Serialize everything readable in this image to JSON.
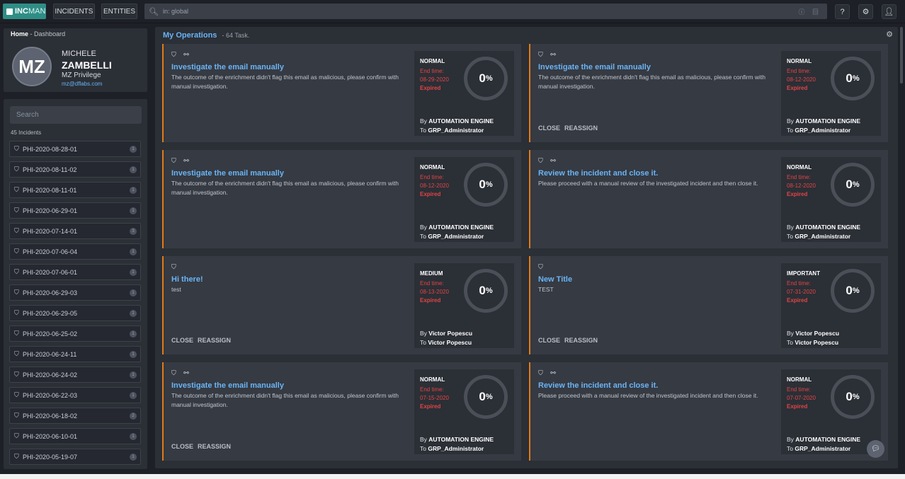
{
  "app": {
    "logo_bold": "INC",
    "logo_light": "MAN",
    "nav": [
      "INCIDENTS",
      "ENTITIES"
    ],
    "search_text": "in: global",
    "search_right_icons": "ⓘ ▤",
    "toolbar_icons": [
      "help-icon",
      "gear-icon",
      "user-icon"
    ]
  },
  "sidebar": {
    "breadcrumb_home": "Home",
    "breadcrumb_sep": "-",
    "breadcrumb_current": "Dashboard",
    "avatar": "MZ",
    "first_name": "MICHELE",
    "last_name": "ZAMBELLI",
    "privilege": "MZ Privilege",
    "email": "mz@dflabs.com",
    "search_placeholder": "Search",
    "incident_count": "45 Incidents",
    "incidents": [
      {
        "id": "PHI-2020-08-28-01",
        "count": "1"
      },
      {
        "id": "PHI-2020-08-11-02",
        "count": "1"
      },
      {
        "id": "PHI-2020-08-11-01",
        "count": "1"
      },
      {
        "id": "PHI-2020-06-29-01",
        "count": "1"
      },
      {
        "id": "PHI-2020-07-14-01",
        "count": "3"
      },
      {
        "id": "PHI-2020-07-06-04",
        "count": "1"
      },
      {
        "id": "PHI-2020-07-06-01",
        "count": "1"
      },
      {
        "id": "PHI-2020-06-29-03",
        "count": "1"
      },
      {
        "id": "PHI-2020-06-29-05",
        "count": "1"
      },
      {
        "id": "PHI-2020-06-25-02",
        "count": "1"
      },
      {
        "id": "PHI-2020-06-24-11",
        "count": "1"
      },
      {
        "id": "PHI-2020-06-24-02",
        "count": "1"
      },
      {
        "id": "PHI-2020-06-22-03",
        "count": "1"
      },
      {
        "id": "PHI-2020-06-18-02",
        "count": "2"
      },
      {
        "id": "PHI-2020-06-10-01",
        "count": "1"
      },
      {
        "id": "PHI-2020-05-19-07",
        "count": "1"
      }
    ]
  },
  "main": {
    "title": "My Operations",
    "subtitle": "- 64 Task.",
    "end_label": "End time:",
    "expired_label": "Expired",
    "by_label": "By",
    "to_label": "To",
    "close_label": "CLOSE",
    "reassign_label": "REASSIGN",
    "tasks": [
      {
        "title": "Investigate the email manually",
        "desc": "The outcome of the enrichment didn't flag this email as malicious, please confirm with manual investigation.",
        "priority": "NORMAL",
        "end": "08-29-2020",
        "progress": "0",
        "by": "AUTOMATION ENGINE",
        "to": "GRP_Administrator",
        "icons": "⛉ ⚯",
        "actions": false
      },
      {
        "title": "Investigate the email manually",
        "desc": "The outcome of the enrichment didn't flag this email as malicious, please confirm with manual investigation.",
        "priority": "NORMAL",
        "end": "08-12-2020",
        "progress": "0",
        "by": "AUTOMATION ENGINE",
        "to": "GRP_Administrator",
        "icons": "⛉ ⚯",
        "actions": true
      },
      {
        "title": "Investigate the email manually",
        "desc": "The outcome of the enrichment didn't flag this email as malicious, please confirm with manual investigation.",
        "priority": "NORMAL",
        "end": "08-12-2020",
        "progress": "0",
        "by": "AUTOMATION ENGINE",
        "to": "GRP_Administrator",
        "icons": "⛉ ⚯",
        "actions": false
      },
      {
        "title": "Review the incident and close it.",
        "desc": "Please proceed with a manual review of the investigated incident and then close it.",
        "priority": "NORMAL",
        "end": "08-12-2020",
        "progress": "0",
        "by": "AUTOMATION ENGINE",
        "to": "GRP_Administrator",
        "icons": "⛉ ⚯",
        "actions": false
      },
      {
        "title": "Hi there!",
        "desc": "test",
        "priority": "MEDIUM",
        "end": "08-13-2020",
        "progress": "0",
        "by": "Victor Popescu",
        "to": "Victor Popescu",
        "icons": "⛉",
        "actions": true
      },
      {
        "title": "New Title",
        "desc": "TEST",
        "priority": "IMPORTANT",
        "end": "07-31-2020",
        "progress": "0",
        "by": "Victor Popescu",
        "to": "Victor Popescu",
        "icons": "⛉",
        "actions": true
      },
      {
        "title": "Investigate the email manually",
        "desc": "The outcome of the enrichment didn't flag this email as malicious, please confirm with manual investigation.",
        "priority": "NORMAL",
        "end": "07-15-2020",
        "progress": "0",
        "by": "AUTOMATION ENGINE",
        "to": "GRP_Administrator",
        "icons": "⛉ ⚯",
        "actions": true
      },
      {
        "title": "Review the incident and close it.",
        "desc": "Please proceed with a manual review of the investigated incident and then close it.",
        "priority": "NORMAL",
        "end": "07-07-2020",
        "progress": "0",
        "by": "AUTOMATION ENGINE",
        "to": "GRP_Administrator",
        "icons": "⛉ ⚯",
        "actions": false
      }
    ]
  },
  "colors": {
    "accent": "#6ab4f5",
    "brand": "#2e8e86",
    "expired": "#e04545",
    "task_border": "#e07b16"
  }
}
